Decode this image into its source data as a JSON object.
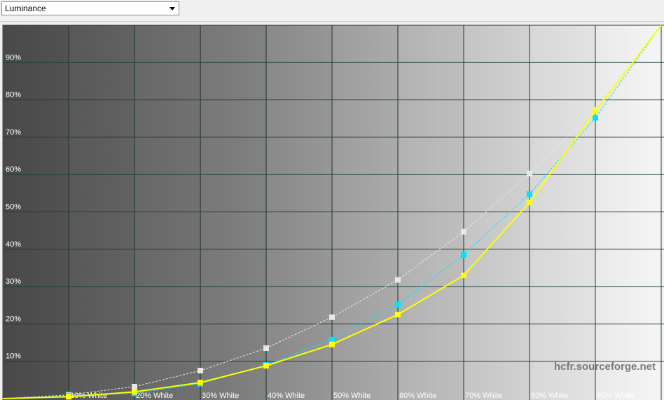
{
  "toolbar": {
    "view_select": {
      "selected": "Luminance"
    }
  },
  "watermark": "hcfr.sourceforge.net",
  "colors": {
    "measured": "#ffff00",
    "reference_cyan": "#00e5ff",
    "reference_white": "#e8e8e8",
    "grid": "#1e3c3c"
  },
  "chart_data": {
    "type": "line",
    "ylim": [
      0,
      100
    ],
    "xlim": [
      0,
      100
    ],
    "x_tick_labels": [
      "10% White",
      "20% White",
      "30% White",
      "40% White",
      "50% White",
      "60% White",
      "70% White",
      "80% White",
      "90% White"
    ],
    "y_tick_labels": [
      "10%",
      "20%",
      "30%",
      "40%",
      "50%",
      "60%",
      "70%",
      "80%",
      "90%"
    ],
    "x": [
      0,
      10,
      20,
      30,
      40,
      50,
      60,
      70,
      80,
      90,
      100
    ],
    "series": [
      {
        "color": "#ffff00",
        "style": "solid",
        "markers": true,
        "values": [
          0,
          0.5,
          1.8,
          4.3,
          8.8,
          14.5,
          22.5,
          33.0,
          52.5,
          77.0,
          100
        ]
      },
      {
        "color": "#00e5ff",
        "style": "dashed",
        "markers": true,
        "values": [
          0,
          0.8,
          1.4,
          4.0,
          9.0,
          15.8,
          25.2,
          38.5,
          54.8,
          75.2,
          100
        ]
      },
      {
        "color": "#e8e8e8",
        "style": "dashed",
        "markers": true,
        "values": [
          0,
          1.0,
          3.2,
          7.5,
          13.5,
          21.8,
          31.8,
          44.7,
          60.3,
          77.3,
          100
        ]
      }
    ]
  }
}
